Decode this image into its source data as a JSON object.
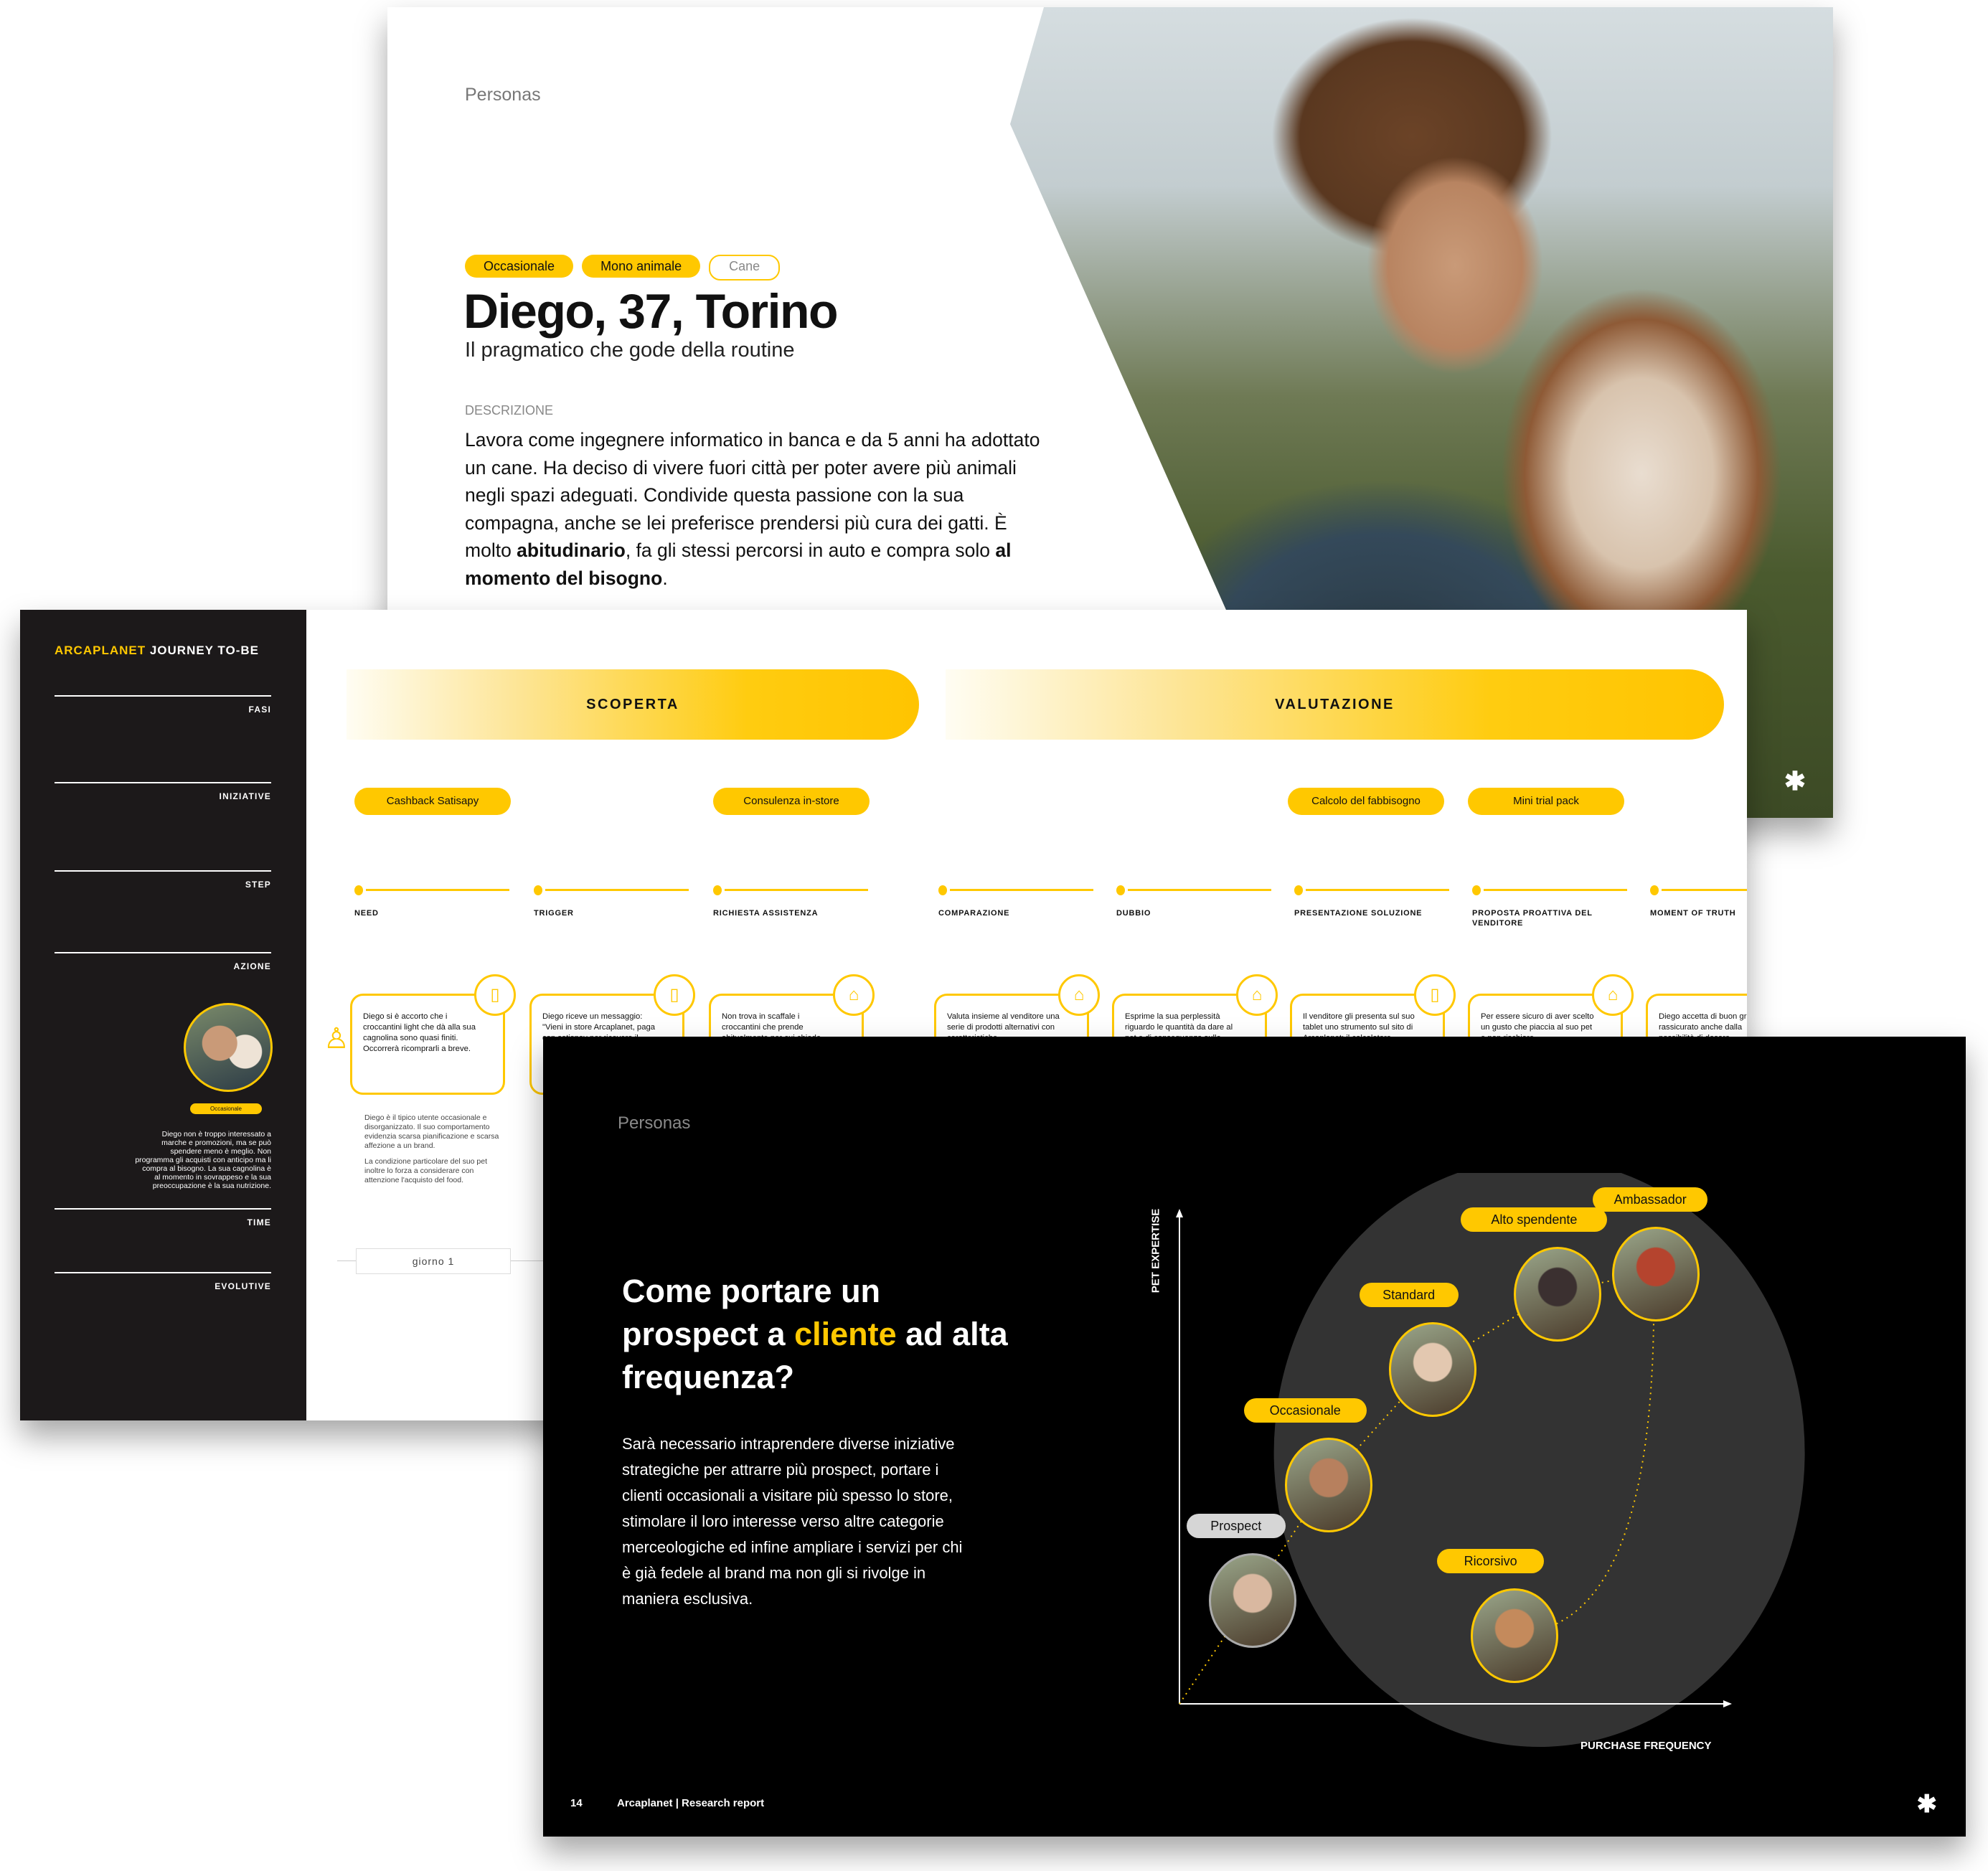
{
  "slide_persona": {
    "kicker": "Personas",
    "tags": [
      "Occasionale",
      "Mono animale",
      "Cane"
    ],
    "name": "Diego, 37, Torino",
    "subtitle": "Il pragmatico che gode della routine",
    "description_label": "DESCRIZIONE",
    "description_parts": [
      {
        "text": "Lavora come ingegnere informatico in banca e da 5 anni ha adottato un cane. Ha deciso di vivere fuori città per poter avere più animali negli spazi adeguati. Condivide questa passione con la sua compagna, anche se lei preferisce prendersi più cura dei gatti. È molto ",
        "bold": false
      },
      {
        "text": "abitudinario",
        "bold": true
      },
      {
        "text": ", fa gli stessi percorsi in auto e compra solo ",
        "bold": false
      },
      {
        "text": "al momento del bisogno",
        "bold": true
      },
      {
        "text": ".",
        "bold": false
      }
    ],
    "photo": "man-with-dog-photo",
    "logo_icon": "arcaplanet-logo-icon"
  },
  "slide_journey": {
    "title_brand": "ARCAPLANET",
    "title_rest": " JOURNEY TO-BE",
    "rows": [
      "FASI",
      "INIZIATIVE",
      "STEP",
      "AZIONE",
      "TIME",
      "EVOLUTIVE"
    ],
    "persona_tag": "Occasionale",
    "persona_text": "Diego non è troppo interessato a marche e promozioni, ma se può spendere meno è meglio. Non programma gli acquisti con anticipo ma li compra al bisogno. La sua cagnolina è al momento in sovrappeso e la sua preoccupazione è la sua nutrizione.",
    "phases": [
      "SCOPERTA",
      "VALUTAZIONE"
    ],
    "initiatives": [
      "Cashback Satisapy",
      "Consulenza in-store",
      "Calcolo del fabbisogno",
      "Mini trial pack"
    ],
    "steps": [
      "NEED",
      "TRIGGER",
      "RICHIESTA ASSISTENZA",
      "COMPARAZIONE",
      "DUBBIO",
      "PRESENTAZIONE SOLUZIONE",
      "PROPOSTA PROATTIVA DEL VENDITORE",
      "MOMENT OF TRUTH"
    ],
    "actions": [
      {
        "text": "Diego si è accorto che i croccantini light che dà alla sua cagnolina sono quasi finiti. Occorrerà ricomprarli a breve.",
        "icon": "smartphone-icon"
      },
      {
        "text": "Diego riceve un messaggio: \"Vieni in store Arcaplanet, paga con satispay per ricevere il",
        "icon": "smartphone-icon"
      },
      {
        "text": "Non trova in scaffale i croccantini che prende abitualmente per cui chiede",
        "icon": "store-icon"
      },
      {
        "text": "Valuta insieme al venditore una serie di prodotti alternativi con caratteristiche",
        "icon": "store-icon"
      },
      {
        "text": "Esprime la sua perplessità riguardo le quantità da dare al pet e di conseguenza sulle",
        "icon": "store-icon"
      },
      {
        "text": "Il venditore gli presenta sul suo tablet uno strumento sul sito di Arcaplanet: il calcolatore",
        "icon": "smartphone-icon"
      },
      {
        "text": "Per essere sicuro di aver scelto un gusto che piaccia al suo pet e non rischiare",
        "icon": "store-icon"
      },
      {
        "text": "Diego accetta di buon grado, rassicurato anche dalla possibilità di dosare",
        "icon": "store-icon"
      }
    ],
    "persona_note": [
      "Diego è il tipico utente occasionale e disorganizzato. Il suo comportamento evidenzia scarsa pianificazione e scarsa affezione a un brand.",
      "La condizione particolare del suo pet inoltre lo forza a considerare con attenzione l'acquisto del food."
    ],
    "time_label": "giorno 1"
  },
  "slide_chart": {
    "kicker": "Personas",
    "heading_pre": "Come portare un prospect a ",
    "heading_highlight": "cliente",
    "heading_post": " ad alta frequenza?",
    "body": "Sarà necessario intraprendere diverse iniziative strategiche per attrarre più prospect, portare i clienti occasionali a visitare più spesso lo store, stimolare il loro interesse verso altre categorie merceologiche ed infine ampliare i servizi per chi è già fedele al brand ma non gli si rivolge in maniera esclusiva.",
    "footer_page": "14",
    "footer_title": "Arcaplanet | Research report",
    "accent": "#ffc800"
  },
  "chart_data": {
    "type": "scatter",
    "title": "",
    "xlabel": "PURCHASE FREQUENCY",
    "ylabel": "PET EXPERTISE",
    "xlim": [
      0,
      100
    ],
    "ylim": [
      0,
      100
    ],
    "grid": false,
    "points": [
      {
        "label": "Prospect",
        "x": 13,
        "y": 21,
        "highlight": false
      },
      {
        "label": "Occasionale",
        "x": 27,
        "y": 44,
        "highlight": true
      },
      {
        "label": "Standard",
        "x": 46,
        "y": 67,
        "highlight": true
      },
      {
        "label": "Alto spendente",
        "x": 69,
        "y": 82,
        "highlight": true
      },
      {
        "label": "Ambassador",
        "x": 87,
        "y": 86,
        "highlight": true
      },
      {
        "label": "Ricorsivo",
        "x": 61,
        "y": 14,
        "highlight": true
      }
    ],
    "paths": [
      [
        "Prospect",
        "Occasionale",
        "Standard",
        "Alto spendente",
        "Ambassador"
      ],
      [
        "Ricorsivo",
        "Ambassador"
      ]
    ],
    "annotations": [
      "customer-zone-circle"
    ]
  }
}
